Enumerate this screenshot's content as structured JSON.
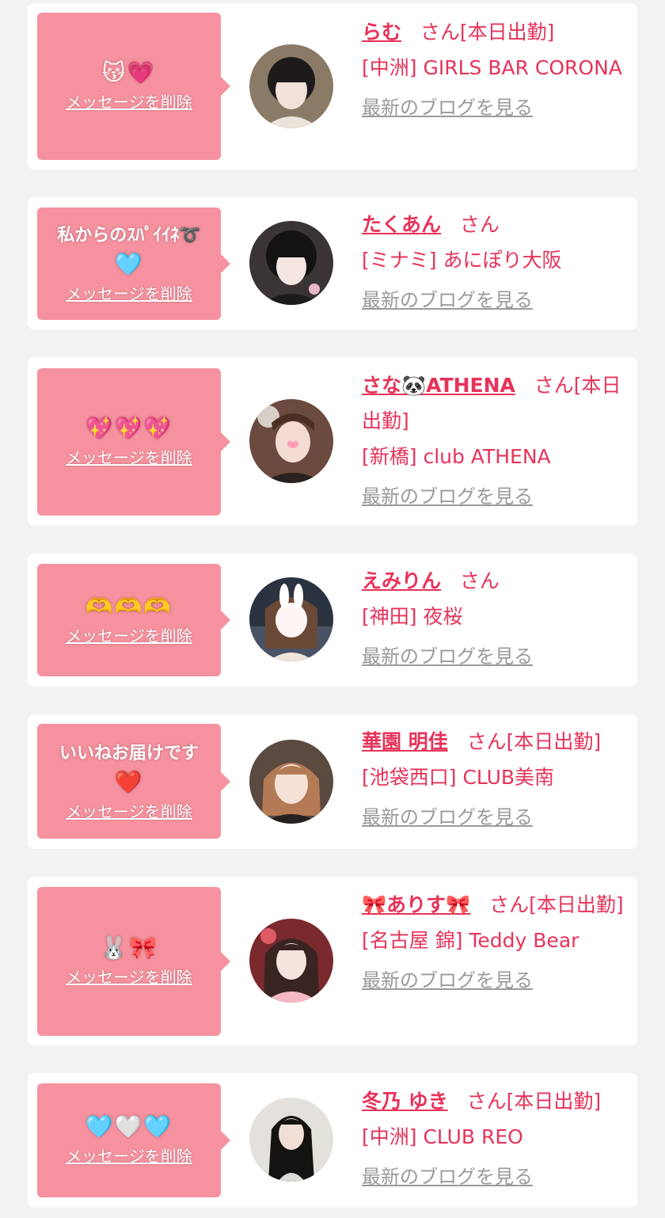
{
  "delete_label": "メッセージを削除",
  "blog_label": "最新のブログを見る",
  "honorific": "さん",
  "cards": [
    {
      "message": "😽💗",
      "name": "らむ",
      "status": "[本日出勤]",
      "shop": "[中洲] GIRLS BAR CORONA"
    },
    {
      "message": "私からのｽﾊﾟｲｲﾈ➰",
      "message2": "🩵",
      "name": "たくあん",
      "status": "",
      "shop": "[ミナミ] あにぽり大阪"
    },
    {
      "message": "💖💖💖",
      "name": "さな🐼ATHENA",
      "status": "[本日出勤]",
      "shop": "[新橋] club ATHENA"
    },
    {
      "message": "🫶🫶🫶",
      "name": "えみりん",
      "status": "",
      "shop": "[神田] 夜桜"
    },
    {
      "message": "いいねお届けです",
      "message2": "❤️",
      "name": "華園 明佳",
      "status": "[本日出勤]",
      "shop": "[池袋西口] CLUB美南"
    },
    {
      "message": "🐰🎀",
      "name": "🎀ありす🎀",
      "status": "[本日出勤]",
      "shop": "[名古屋 錦] Teddy Bear"
    },
    {
      "message": "🩵🤍🩵",
      "name": "冬乃 ゆき",
      "status": "[本日出勤]",
      "shop": "[中洲] CLUB REO"
    }
  ]
}
